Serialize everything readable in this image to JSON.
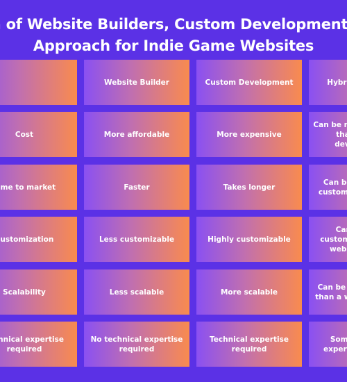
{
  "title": {
    "line1": "Comparison of Website Builders, Custom Development and Hybrid",
    "line2": "Approach for Indie Game Websites"
  },
  "colors": {
    "background": "#5b31e6",
    "cell_gradient_start": "#8a50f2",
    "cell_gradient_end": "#f98b4e",
    "text": "#ffffff"
  },
  "table": {
    "headers": [
      "",
      "Website Builder",
      "Custom Development",
      "Hybrid Approach"
    ],
    "rows": [
      [
        "Cost",
        "More affordable",
        "More expensive",
        "Can be more affordable than custom development"
      ],
      [
        "Time to market",
        "Faster",
        "Takes longer",
        "Can be faster than custom development"
      ],
      [
        "Customization",
        "Less customizable",
        "Highly customizable",
        "Can be more customizable than a website builder"
      ],
      [
        "Scalability",
        "Less scalable",
        "More scalable",
        "Can be more scalable than a website builder"
      ],
      [
        "Technical expertise required",
        "No technical expertise required",
        "Technical expertise required",
        "Some technical expertise required"
      ]
    ]
  }
}
